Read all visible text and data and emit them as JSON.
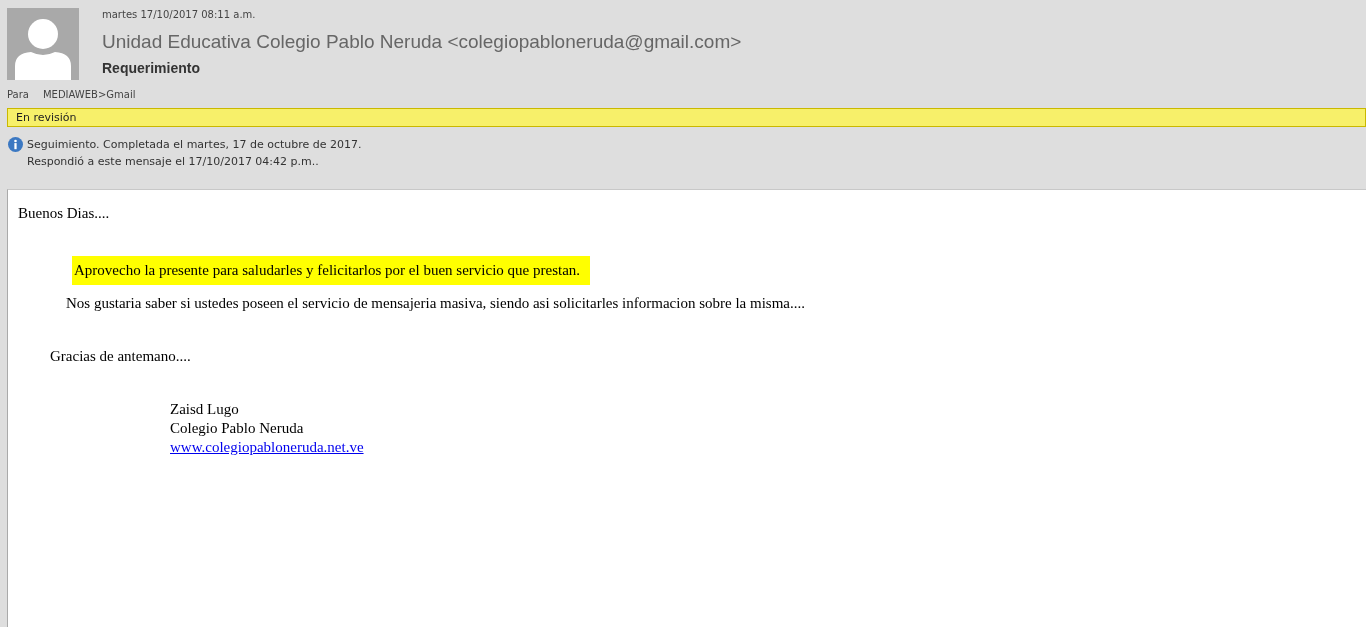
{
  "header": {
    "date": "martes 17/10/2017 08:11 a.m.",
    "sender": "Unidad Educativa Colegio Pablo Neruda <colegiopabloneruda@gmail.com>",
    "subject": "Requerimiento",
    "to_label": "Para",
    "to": "MEDIAWEB>Gmail"
  },
  "category": {
    "label": "En revisión",
    "color": "#f7f06a"
  },
  "info": [
    "Seguimiento.  Completada el martes, 17 de octubre de 2017.",
    "Respondió a este mensaje el 17/10/2017 04:42 p.m.."
  ],
  "body": [
    {
      "kind": "greeting",
      "text": "Buenos Dias...."
    },
    {
      "kind": "highlight",
      "text": "Aprovecho la presente para saludarles y felicitarlos por el buen servicio que prestan."
    },
    {
      "kind": "paragraph",
      "text": "Nos gustaria saber si ustedes poseen el servicio de mensajeria masiva, siendo asi solicitarles informacion sobre la misma...."
    },
    {
      "kind": "closing",
      "text": "Gracias de antemano...."
    }
  ],
  "signature": [
    {
      "kind": "text",
      "text": "Zaisd Lugo"
    },
    {
      "kind": "text",
      "text": "Colegio Pablo Neruda"
    },
    {
      "kind": "link",
      "text": "www.colegiopabloneruda.net.ve"
    }
  ]
}
